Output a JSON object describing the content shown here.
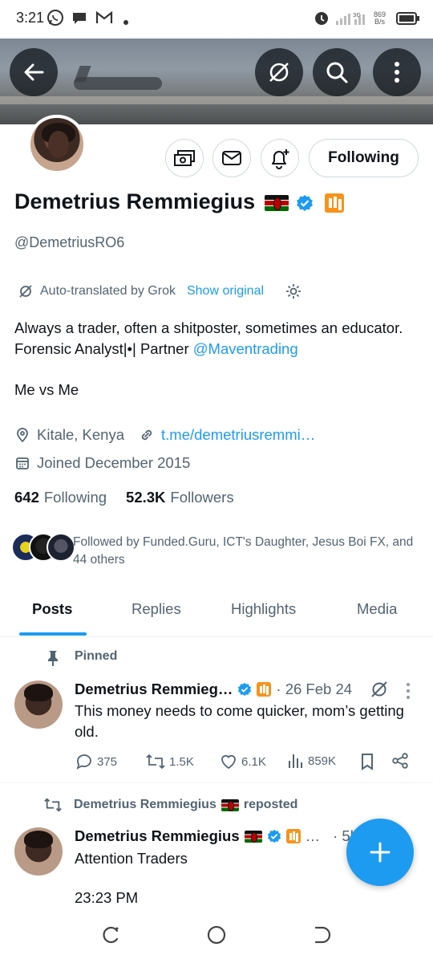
{
  "status_bar": {
    "time": "3:21",
    "net_speed_value": "869",
    "net_speed_unit": "B/s"
  },
  "header": {
    "back_icon": "arrow-left-icon",
    "translate_icon": "grok-translate-icon",
    "search_icon": "search-icon",
    "more_icon": "more-vertical-icon"
  },
  "profile": {
    "display_name": "Demetrius Remmiegius",
    "handle": "@DemetriusRO6",
    "follow_label": "Following",
    "translate_note": "Auto-translated by Grok",
    "show_original": "Show original",
    "bio_text": "Always a trader, often a shitposter, sometimes an educator. Forensic Analyst|•| Partner ",
    "bio_mention": "@Maventrading",
    "motto": "Me vs Me",
    "location": "Kitale, Kenya",
    "website": "t.me/demetriusremmi…",
    "joined": "Joined December 2015",
    "following_count": "642",
    "following_label": "Following",
    "followers_count": "52.3K",
    "followers_label": "Followers",
    "followed_by": "Followed by Funded.Guru, ICT's Daughter, Jesus Boi FX, and 44 others"
  },
  "tabs": [
    "Posts",
    "Replies",
    "Highlights",
    "Media"
  ],
  "pinned_post": {
    "pinned_label": "Pinned",
    "author": "Demetrius Remmieg…",
    "date": "· 26 Feb 24",
    "text": "This money needs to come quicker, mom’s getting old.",
    "replies": "375",
    "reposts": "1.5K",
    "likes": "6.1K",
    "views": "859K"
  },
  "repost": {
    "reposted_label": "Demetrius Remmiegius",
    "reposted_suffix": "reposted",
    "author": "Demetrius Remmiegius",
    "ellipsis": "…",
    "time": "· 5h",
    "text": "Attention Traders",
    "text2": "23:23 PM"
  },
  "colors": {
    "accent": "#1d9bf0",
    "text_primary": "#0f1419",
    "text_secondary": "#536471",
    "border": "#cfd9de"
  }
}
